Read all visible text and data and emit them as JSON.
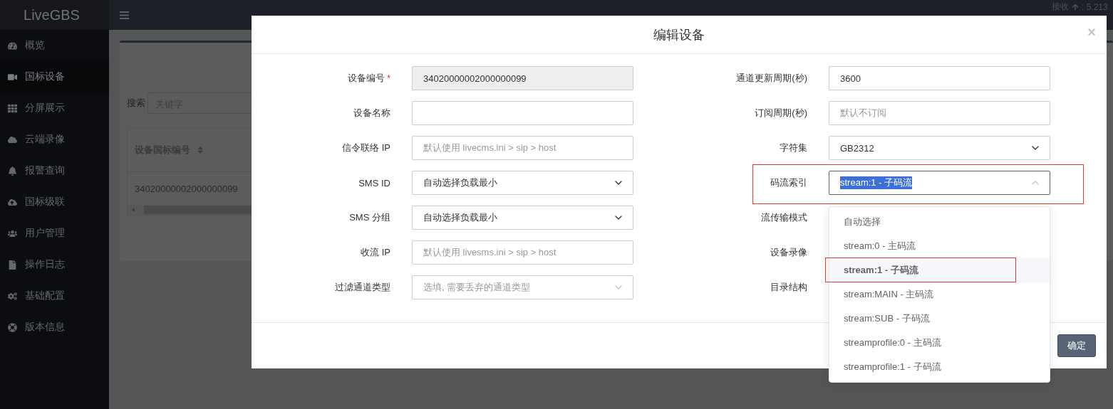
{
  "sidebar": {
    "brand": "LiveGBS",
    "items": [
      {
        "label": "概览",
        "selected": false
      },
      {
        "label": "国标设备",
        "selected": true
      },
      {
        "label": "分屏展示",
        "selected": false
      },
      {
        "label": "云端录像",
        "selected": false
      },
      {
        "label": "报警查询",
        "selected": false
      },
      {
        "label": "国标级联",
        "selected": false
      },
      {
        "label": "用户管理",
        "selected": false
      },
      {
        "label": "操作日志",
        "selected": false
      },
      {
        "label": "基础配置",
        "selected": false
      },
      {
        "label": "版本信息",
        "selected": false
      }
    ]
  },
  "header": {
    "rate_label": "接收",
    "rate_value": ": 5.213"
  },
  "background_panel": {
    "search_label": "搜索",
    "search_placeholder": "关键字",
    "columns": [
      "设备国标编号"
    ],
    "rows": [
      [
        "34020000002000000099"
      ]
    ]
  },
  "dialog": {
    "title": "编辑设备",
    "close": "×",
    "left_fields": [
      {
        "label": "设备编号",
        "required_mark": "*",
        "kind": "readonly",
        "value": "34020000002000000099"
      },
      {
        "label": "设备名称",
        "kind": "input"
      },
      {
        "label": "信令联络 IP",
        "kind": "input",
        "placeholder": "默认使用 livecms.ini > sip > host"
      },
      {
        "label": "SMS ID",
        "kind": "select",
        "value": "自动选择负载最小"
      },
      {
        "label": "SMS 分组",
        "kind": "select",
        "value": "自动选择负载最小"
      },
      {
        "label": "收流 IP",
        "kind": "input",
        "placeholder": "默认使用 livesms.ini > sip > host"
      },
      {
        "label": "过滤通道类型",
        "kind": "multiselect",
        "placeholder": "选填, 需要丢弃的通道类型"
      }
    ],
    "right_fields": [
      {
        "label": "通道更新周期(秒)",
        "kind": "input",
        "value": "3600",
        "annotated": false
      },
      {
        "label": "订阅周期(秒)",
        "kind": "input",
        "placeholder": "默认不订阅",
        "annotated": false
      },
      {
        "label": "字符集",
        "kind": "select",
        "value": "GB2312",
        "annotated": false
      },
      {
        "label": "码流索引",
        "kind": "open-select",
        "value": "stream:1 - 子码流",
        "annotated": true,
        "options": [
          {
            "label": "自动选择",
            "selected": false,
            "annotated": false
          },
          {
            "label": "stream:0 - 主码流",
            "selected": false,
            "annotated": false
          },
          {
            "label": "stream:1 - 子码流",
            "selected": true,
            "annotated": true
          },
          {
            "label": "stream:MAIN - 主码流",
            "selected": false,
            "annotated": false
          },
          {
            "label": "stream:SUB - 子码流",
            "selected": false,
            "annotated": false
          },
          {
            "label": "streamprofile:0 - 主码流",
            "selected": false,
            "annotated": false
          },
          {
            "label": "streamprofile:1 - 子码流",
            "selected": false,
            "annotated": false
          }
        ]
      },
      {
        "label": "流传输模式",
        "kind": "covered",
        "annotated": false
      },
      {
        "label": "设备录像",
        "kind": "covered",
        "annotated": false
      },
      {
        "label": "目录结构",
        "kind": "covered",
        "annotated": false
      }
    ],
    "buttons": [
      {
        "label": "确定"
      }
    ]
  }
}
